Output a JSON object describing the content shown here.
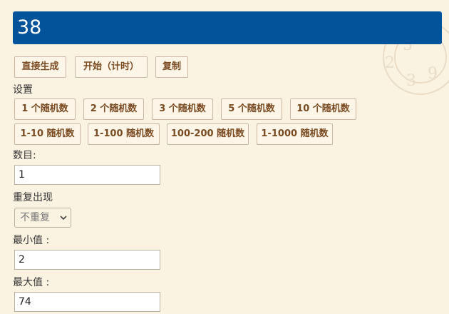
{
  "result": {
    "value": "38"
  },
  "actions": {
    "generate": "直接生成",
    "start_timer": "开始（计时）",
    "copy": "复制"
  },
  "settings": {
    "title": "设置",
    "presets_row1": [
      "1 个随机数",
      "2 个随机数",
      "3 个随机数",
      "5 个随机数",
      "10 个随机数"
    ],
    "presets_row2": [
      "1-10 随机数",
      "1-100 随机数",
      "100-200 随机数",
      "1-1000 随机数"
    ]
  },
  "fields": {
    "count_label": "数目:",
    "count_value": "1",
    "repeat_label": "重复出现",
    "repeat_selected": "不重复",
    "min_label": "最小值   :",
    "min_value": "2",
    "max_label": "最大值   :",
    "max_value": "74"
  },
  "colors": {
    "result_bg": "#02539a",
    "page_bg": "#fbf3e2",
    "button_text": "#7a4a22"
  }
}
